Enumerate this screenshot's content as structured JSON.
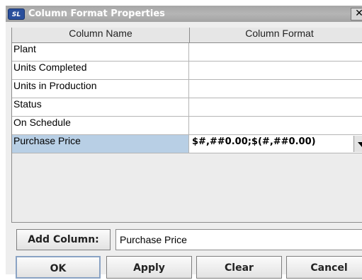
{
  "window": {
    "title": "Column Format Properties",
    "icon_label": "SL",
    "close_glyph": "✕"
  },
  "table": {
    "headers": [
      "Column Name",
      "Column Format"
    ],
    "rows": [
      {
        "name": "Plant",
        "format": ""
      },
      {
        "name": "Units Completed",
        "format": ""
      },
      {
        "name": "Units in Production",
        "format": ""
      },
      {
        "name": "Status",
        "format": ""
      },
      {
        "name": "On Schedule",
        "format": ""
      },
      {
        "name": "Purchase Price",
        "format": "$#,##0.00;$(#,##0.00)",
        "selected": true
      }
    ]
  },
  "add_column": {
    "button_label": "Add Column:",
    "value": "Purchase Price"
  },
  "buttons": {
    "ok": "OK",
    "apply": "Apply",
    "clear": "Clear",
    "cancel": "Cancel"
  },
  "colors": {
    "title_bar": "#a9a9a9",
    "selection": "#b8cfe5",
    "icon_bg": "#2a4f9c"
  }
}
